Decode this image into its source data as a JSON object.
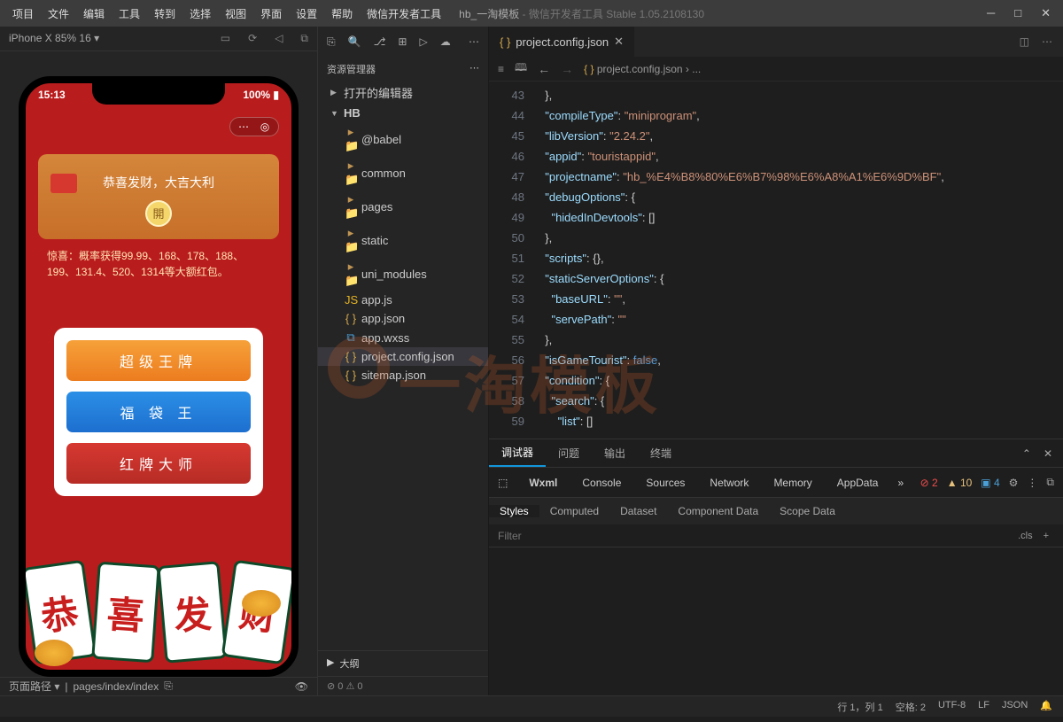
{
  "menu": [
    "项目",
    "文件",
    "编辑",
    "工具",
    "转到",
    "选择",
    "视图",
    "界面",
    "设置",
    "帮助",
    "微信开发者工具"
  ],
  "title": {
    "project": "hb_一淘模板",
    "app": "微信开发者工具 Stable 1.05.2108130"
  },
  "simulator": {
    "device": "iPhone X 85% 16 ▾",
    "pathLabel": "页面路径 ▾",
    "path": "pages/index/index",
    "time": "15:13",
    "battery": "100%",
    "envelopeMsg": "恭喜发财，大吉大利",
    "openBtn": "開",
    "surprise": "惊喜：概率获得99.99、168、178、188、199、131.4、520、1314等大额红包。",
    "cards": [
      "超级王牌",
      "福 袋 王",
      "红牌大师"
    ],
    "tiles": [
      "恭",
      "喜",
      "发",
      "财"
    ]
  },
  "explorer": {
    "title": "资源管理器",
    "sections": {
      "openEditors": "打开的编辑器",
      "root": "HB",
      "outline": "大纲"
    },
    "tree": [
      {
        "type": "folder",
        "name": "@babel",
        "depth": 2
      },
      {
        "type": "folder",
        "name": "common",
        "depth": 2
      },
      {
        "type": "folder",
        "name": "pages",
        "depth": 2
      },
      {
        "type": "folder",
        "name": "static",
        "depth": 2
      },
      {
        "type": "folder",
        "name": "uni_modules",
        "depth": 2
      },
      {
        "type": "js",
        "name": "app.js",
        "depth": 2
      },
      {
        "type": "json",
        "name": "app.json",
        "depth": 2
      },
      {
        "type": "wxss",
        "name": "app.wxss",
        "depth": 2
      },
      {
        "type": "json",
        "name": "project.config.json",
        "depth": 2,
        "selected": true
      },
      {
        "type": "json",
        "name": "sitemap.json",
        "depth": 2
      }
    ],
    "errors": "⊘ 0 ⚠ 0"
  },
  "editor": {
    "tab": "project.config.json",
    "breadcrumb": "project.config.json › ...",
    "startLine": 43,
    "lines": [
      {
        "t": "},",
        "i": 1
      },
      {
        "k": "compileType",
        "v": "miniprogram",
        "c": true,
        "i": 1
      },
      {
        "k": "libVersion",
        "v": "2.24.2",
        "c": true,
        "i": 1
      },
      {
        "k": "appid",
        "v": "touristappid",
        "c": true,
        "i": 1
      },
      {
        "k": "projectname",
        "v": "hb_%E4%B8%80%E6%B7%98%E6%A8%A1%E6%9D%BF",
        "c": true,
        "i": 1
      },
      {
        "k": "debugOptions",
        "open": "{",
        "i": 1,
        "fold": true
      },
      {
        "k": "hidedInDevtools",
        "arr": "[]",
        "i": 2
      },
      {
        "t": "},",
        "i": 1
      },
      {
        "k": "scripts",
        "inline": "{},",
        "i": 1
      },
      {
        "k": "staticServerOptions",
        "open": "{",
        "i": 1,
        "fold": true
      },
      {
        "k": "baseURL",
        "v": "",
        "c": true,
        "i": 2
      },
      {
        "k": "servePath",
        "v": "",
        "c": false,
        "i": 2
      },
      {
        "t": "},",
        "i": 1
      },
      {
        "k": "isGameTourist",
        "b": "false",
        "c": true,
        "i": 1
      },
      {
        "k": "condition",
        "open": "{",
        "i": 1,
        "fold": true
      },
      {
        "k": "search",
        "open": "{",
        "i": 2,
        "fold": true
      },
      {
        "k": "list",
        "arr": "[]",
        "i": 3
      }
    ]
  },
  "debugger": {
    "tabs": [
      "调试器",
      "问题",
      "输出",
      "终端"
    ],
    "subTabs": [
      "Wxml",
      "Console",
      "Sources",
      "Network",
      "Memory",
      "AppData"
    ],
    "badges": {
      "err": "2",
      "warn": "10",
      "info": "4"
    },
    "styleTabs": [
      "Styles",
      "Computed",
      "Dataset",
      "Component Data",
      "Scope Data"
    ],
    "filterPlaceholder": "Filter",
    "cls": ".cls"
  },
  "statusbar": {
    "pos": "行 1，列 1",
    "space": "空格: 2",
    "enc": "UTF-8",
    "eol": "LF",
    "lang": "JSON"
  },
  "watermark": "一淘模板"
}
